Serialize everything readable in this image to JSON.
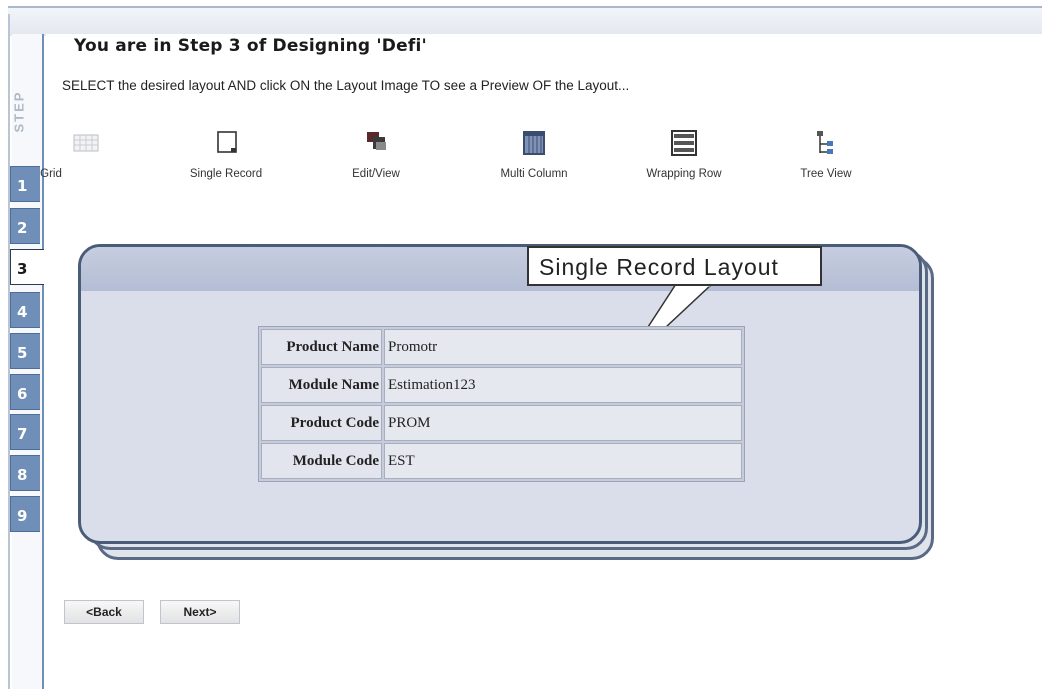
{
  "steps": {
    "label": "STEP",
    "items": [
      "1",
      "2",
      "3",
      "4",
      "5",
      "6",
      "7",
      "8",
      "9"
    ],
    "active": "3"
  },
  "header": {
    "title": "You are in Step 3 of Designing 'Defi'",
    "instruction": "SELECT the desired layout AND click ON the Layout Image TO see a Preview OF the Layout..."
  },
  "layouts": [
    {
      "label": "Grid",
      "icon": "grid-icon"
    },
    {
      "label": "Single Record",
      "icon": "single-record-icon"
    },
    {
      "label": "Edit/View",
      "icon": "edit-view-icon"
    },
    {
      "label": "Multi Column",
      "icon": "multi-column-icon"
    },
    {
      "label": "Wrapping Row",
      "icon": "wrapping-row-icon"
    },
    {
      "label": "Tree View",
      "icon": "tree-view-icon"
    }
  ],
  "preview": {
    "callout": "Single Record Layout",
    "rows": [
      {
        "key": "Product Name",
        "value": "Promotr"
      },
      {
        "key": "Module Name",
        "value": "Estimation123"
      },
      {
        "key": "Product Code",
        "value": "PROM"
      },
      {
        "key": "Module Code",
        "value": "EST"
      }
    ]
  },
  "buttons": {
    "back": "<Back",
    "next": "Next>"
  },
  "colors": {
    "step_tab": "#6f8fb8",
    "panel_border": "#4b5c78",
    "panel_fill": "#dadeea"
  }
}
